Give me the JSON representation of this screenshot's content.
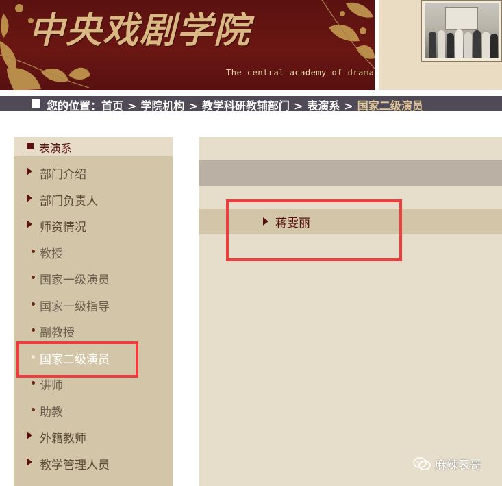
{
  "banner": {
    "title": "中央戏剧学院",
    "subtitle": "The central academy of drama"
  },
  "breadcrumb": {
    "prefix": "您的位置：",
    "items": [
      "首页",
      "学院机构",
      "教学科研教辅部门",
      "表演系"
    ],
    "current": "国家二级演员",
    "separator": ">"
  },
  "sidebar": {
    "heading": "表演系",
    "items": [
      {
        "label": "部门介绍",
        "type": "main"
      },
      {
        "label": "部门负责人",
        "type": "main"
      },
      {
        "label": "师资情况",
        "type": "main"
      },
      {
        "label": "教授",
        "type": "sub"
      },
      {
        "label": "国家一级演员",
        "type": "sub"
      },
      {
        "label": "国家一级指导",
        "type": "sub"
      },
      {
        "label": "副教授",
        "type": "sub"
      },
      {
        "label": "国家二级演员",
        "type": "sub",
        "active": true
      },
      {
        "label": "讲师",
        "type": "sub"
      },
      {
        "label": "助教",
        "type": "sub"
      },
      {
        "label": "外籍教师",
        "type": "main"
      },
      {
        "label": "教学管理人员",
        "type": "main"
      }
    ]
  },
  "main": {
    "entries": [
      "蒋雯丽"
    ]
  },
  "watermark": {
    "text": "麻辣表哥",
    "icon": "wechat-icon"
  },
  "colors": {
    "banner_bg": "#5a1210",
    "gold": "#d9b884",
    "crumb_bar": "#4f4a56",
    "sidebar_bg": "#d3c6a8",
    "highlight": "#f03c3c"
  }
}
